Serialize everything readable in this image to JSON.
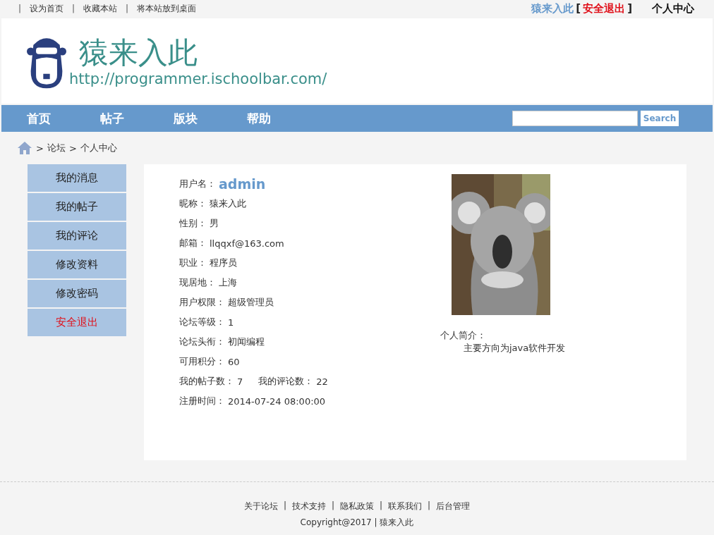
{
  "top_bar": {
    "separator": "|",
    "links": [
      {
        "label": "设为首页"
      },
      {
        "label": "收藏本站"
      },
      {
        "label": "将本站放到桌面"
      }
    ],
    "user": {
      "name": "猿来入此",
      "bracket_open": "[",
      "logout": "安全退出",
      "bracket_close": "]"
    },
    "profile_link": "个人中心"
  },
  "header": {
    "site_name": "猿来入此",
    "url": "http://programmer.ischoolbar.com/"
  },
  "nav": {
    "items": [
      {
        "label": "首页"
      },
      {
        "label": "帖子"
      },
      {
        "label": "版块"
      },
      {
        "label": "帮助"
      }
    ],
    "search_button": "Search"
  },
  "breadcrumb": {
    "separator": ">",
    "items": [
      "论坛",
      "个人中心"
    ]
  },
  "sidebar": {
    "items": [
      {
        "label": "我的消息",
        "kind": "link"
      },
      {
        "label": "我的帖子",
        "kind": "link"
      },
      {
        "label": "我的评论",
        "kind": "link"
      },
      {
        "label": "修改资料",
        "kind": "link"
      },
      {
        "label": "修改密码",
        "kind": "link"
      },
      {
        "label": "安全退出",
        "kind": "logout"
      }
    ]
  },
  "profile": {
    "rows": [
      {
        "fields": [
          {
            "label": "用户名：",
            "value": "admin",
            "kind": "username"
          }
        ]
      },
      {
        "fields": [
          {
            "label": "昵称：",
            "value": "猿来入此",
            "kind": "plain"
          }
        ]
      },
      {
        "fields": [
          {
            "label": "性别：",
            "value": "男",
            "kind": "plain"
          }
        ]
      },
      {
        "fields": [
          {
            "label": "邮箱：",
            "value": "llqqxf@163.com",
            "kind": "plain"
          }
        ]
      },
      {
        "fields": [
          {
            "label": "职业：",
            "value": "程序员",
            "kind": "plain"
          }
        ]
      },
      {
        "fields": [
          {
            "label": "现居地：",
            "value": "上海",
            "kind": "plain"
          }
        ]
      },
      {
        "fields": [
          {
            "label": "用户权限：",
            "value": "超级管理员",
            "kind": "plain"
          }
        ]
      },
      {
        "fields": [
          {
            "label": "论坛等级：",
            "value": "1",
            "kind": "plain"
          }
        ]
      },
      {
        "fields": [
          {
            "label": "论坛头衔：",
            "value": "初闻编程",
            "kind": "plain"
          }
        ]
      },
      {
        "fields": [
          {
            "label": "可用积分：",
            "value": "60",
            "kind": "plain"
          }
        ]
      },
      {
        "fields": [
          {
            "label": "我的帖子数：",
            "value": "7",
            "kind": "plain"
          },
          {
            "label": "我的评论数：",
            "value": "22",
            "kind": "plain"
          }
        ]
      },
      {
        "fields": [
          {
            "label": "注册时间：",
            "value": "2014-07-24 08:00:00",
            "kind": "plain"
          }
        ]
      }
    ],
    "bio_label": "个人简介：",
    "bio": "主要方向为java软件开发"
  },
  "footer": {
    "separator": "|",
    "links": [
      {
        "label": "关于论坛"
      },
      {
        "label": "技术支持"
      },
      {
        "label": "隐私政策"
      },
      {
        "label": "联系我们"
      },
      {
        "label": "后台管理"
      }
    ],
    "copyright": "Copyright@2017 | 猿来入此"
  }
}
